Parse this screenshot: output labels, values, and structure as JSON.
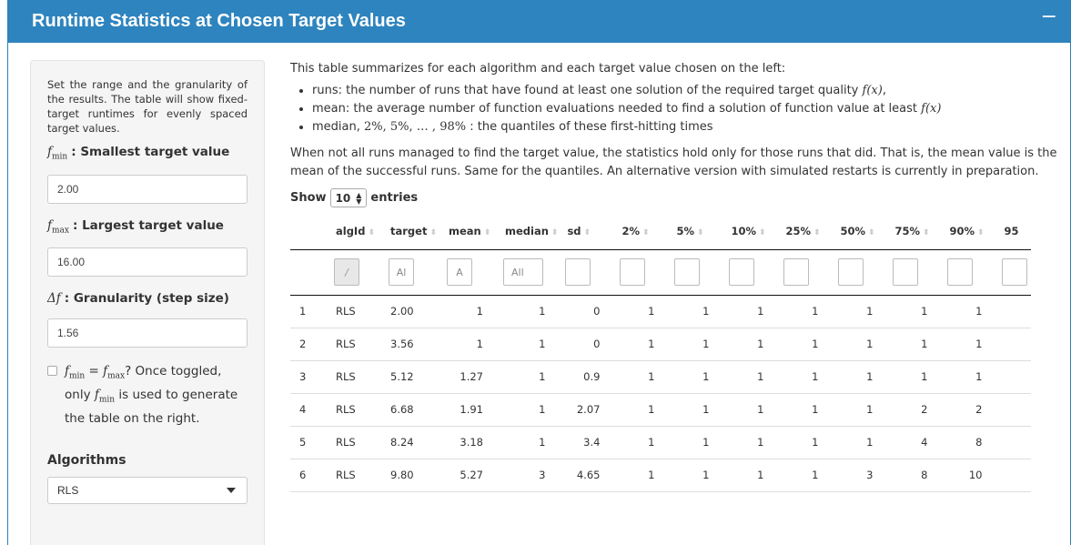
{
  "panel": {
    "title": "Runtime Statistics at Chosen Target Values",
    "collapse": "−"
  },
  "sidebar": {
    "description": "Set the range and the granularity of the results. The table will show fixed-target runtimes for evenly spaced target values.",
    "fmin": {
      "label": ": Smallest target value",
      "value": "2.00"
    },
    "fmax": {
      "label": ": Largest target value",
      "value": "16.00"
    },
    "delta": {
      "label": ": Granularity (step size)",
      "value": "1.56"
    },
    "toggle": {
      "text_a": "? Once toggled, only",
      "text_b": "is used to generate the table on the right."
    },
    "algorithms": {
      "label": "Algorithms",
      "selected": "RLS"
    }
  },
  "main": {
    "intro": "This table summarizes for each algorithm and each target value chosen on the left:",
    "bullets": {
      "runs": "runs: the number of runs that have found at least one solution of the required target quality",
      "mean": "mean: the average number of function evaluations needed to find a solution of function value at least",
      "median_a": "median,",
      "median_b": ": the quantiles of these first-hitting times"
    },
    "paragraph": "When not all runs managed to find the target value, the statistics hold only for those runs that did. That is, the mean value is the mean of the successful runs. Same for the quantiles. An alternative version with simulated restarts is currently in preparation.",
    "show": {
      "prefix": "Show",
      "value": "10",
      "suffix": "entries"
    }
  },
  "table": {
    "headers": [
      "algId",
      "target",
      "mean",
      "median",
      "sd",
      "2%",
      "5%",
      "10%",
      "25%",
      "50%",
      "75%",
      "90%",
      "95"
    ],
    "filters": [
      "A",
      "Al",
      "A",
      "All"
    ],
    "rows": [
      [
        "1",
        "RLS",
        "2.00",
        "1",
        "1",
        "0",
        "1",
        "1",
        "1",
        "1",
        "1",
        "1",
        "1"
      ],
      [
        "2",
        "RLS",
        "3.56",
        "1",
        "1",
        "0",
        "1",
        "1",
        "1",
        "1",
        "1",
        "1",
        "1"
      ],
      [
        "3",
        "RLS",
        "5.12",
        "1.27",
        "1",
        "0.9",
        "1",
        "1",
        "1",
        "1",
        "1",
        "1",
        "1"
      ],
      [
        "4",
        "RLS",
        "6.68",
        "1.91",
        "1",
        "2.07",
        "1",
        "1",
        "1",
        "1",
        "1",
        "2",
        "2"
      ],
      [
        "5",
        "RLS",
        "8.24",
        "3.18",
        "1",
        "3.4",
        "1",
        "1",
        "1",
        "1",
        "1",
        "4",
        "8"
      ],
      [
        "6",
        "RLS",
        "9.80",
        "5.27",
        "3",
        "4.65",
        "1",
        "1",
        "1",
        "1",
        "3",
        "8",
        "10"
      ]
    ]
  },
  "colors": {
    "header_bg": "#2e84be",
    "sidebar_bg": "#f5f5f5"
  }
}
